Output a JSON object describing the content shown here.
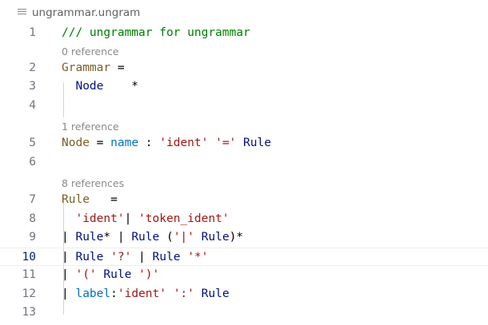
{
  "tab": {
    "title": "ungrammar.ungram",
    "icon": "file-lines-icon"
  },
  "lenses": [
    "0 reference",
    "1 reference",
    "8 references"
  ],
  "lines": [
    {
      "n": "1",
      "tokens": [
        {
          "t": "/// ungrammar for ungrammar",
          "c": "comment"
        }
      ]
    },
    {
      "n": "2",
      "tokens": [
        {
          "t": "Grammar",
          "c": "def"
        },
        {
          "t": " =",
          "c": "op"
        }
      ]
    },
    {
      "n": "3",
      "tokens": [
        {
          "t": "  ",
          "c": "op"
        },
        {
          "t": "Node",
          "c": "kw"
        },
        {
          "t": "    *",
          "c": "op"
        }
      ]
    },
    {
      "n": "4",
      "tokens": []
    },
    {
      "n": "5",
      "tokens": [
        {
          "t": "Node",
          "c": "def"
        },
        {
          "t": " = ",
          "c": "op"
        },
        {
          "t": "name",
          "c": "name"
        },
        {
          "t": " : ",
          "c": "op"
        },
        {
          "t": "'ident'",
          "c": "str"
        },
        {
          "t": " ",
          "c": "op"
        },
        {
          "t": "'='",
          "c": "str"
        },
        {
          "t": " Rule",
          "c": "kw"
        }
      ]
    },
    {
      "n": "6",
      "tokens": []
    },
    {
      "n": "7",
      "tokens": [
        {
          "t": "Rule",
          "c": "def"
        },
        {
          "t": "   =",
          "c": "op"
        }
      ]
    },
    {
      "n": "8",
      "tokens": [
        {
          "t": "  ",
          "c": "op"
        },
        {
          "t": "'ident'",
          "c": "str"
        },
        {
          "t": "| ",
          "c": "op"
        },
        {
          "t": "'token_ident'",
          "c": "str"
        }
      ]
    },
    {
      "n": "9",
      "tokens": [
        {
          "t": "| ",
          "c": "op"
        },
        {
          "t": "Rule",
          "c": "kw"
        },
        {
          "t": "* | ",
          "c": "op"
        },
        {
          "t": "Rule",
          "c": "kw"
        },
        {
          "t": " (",
          "c": "op"
        },
        {
          "t": "'|'",
          "c": "str"
        },
        {
          "t": " ",
          "c": "op"
        },
        {
          "t": "Rule",
          "c": "kw"
        },
        {
          "t": ")*",
          "c": "op"
        }
      ]
    },
    {
      "n": "10",
      "tokens": [
        {
          "t": "| ",
          "c": "op"
        },
        {
          "t": "Rule",
          "c": "kw"
        },
        {
          "t": " ",
          "c": "op"
        },
        {
          "t": "'?'",
          "c": "str"
        },
        {
          "t": " | ",
          "c": "op"
        },
        {
          "t": "Rule",
          "c": "kw"
        },
        {
          "t": " ",
          "c": "op"
        },
        {
          "t": "'*'",
          "c": "str"
        }
      ]
    },
    {
      "n": "11",
      "tokens": [
        {
          "t": "| ",
          "c": "op"
        },
        {
          "t": "'('",
          "c": "str"
        },
        {
          "t": " ",
          "c": "op"
        },
        {
          "t": "Rule",
          "c": "kw"
        },
        {
          "t": " ",
          "c": "op"
        },
        {
          "t": "')'",
          "c": "str"
        }
      ]
    },
    {
      "n": "12",
      "tokens": [
        {
          "t": "| ",
          "c": "op"
        },
        {
          "t": "label",
          "c": "name"
        },
        {
          "t": ":",
          "c": "op"
        },
        {
          "t": "'ident'",
          "c": "str"
        },
        {
          "t": " ",
          "c": "op"
        },
        {
          "t": "':'",
          "c": "str"
        },
        {
          "t": " Rule",
          "c": "kw"
        }
      ]
    },
    {
      "n": "13",
      "tokens": []
    }
  ],
  "current_line": "10",
  "colors": {
    "comment": "#008000",
    "definition": "#795e26",
    "identifier": "#001080",
    "field": "#0070c1",
    "string": "#a31515",
    "line_number": "#6e7681",
    "current_line_number": "#0b216f"
  }
}
